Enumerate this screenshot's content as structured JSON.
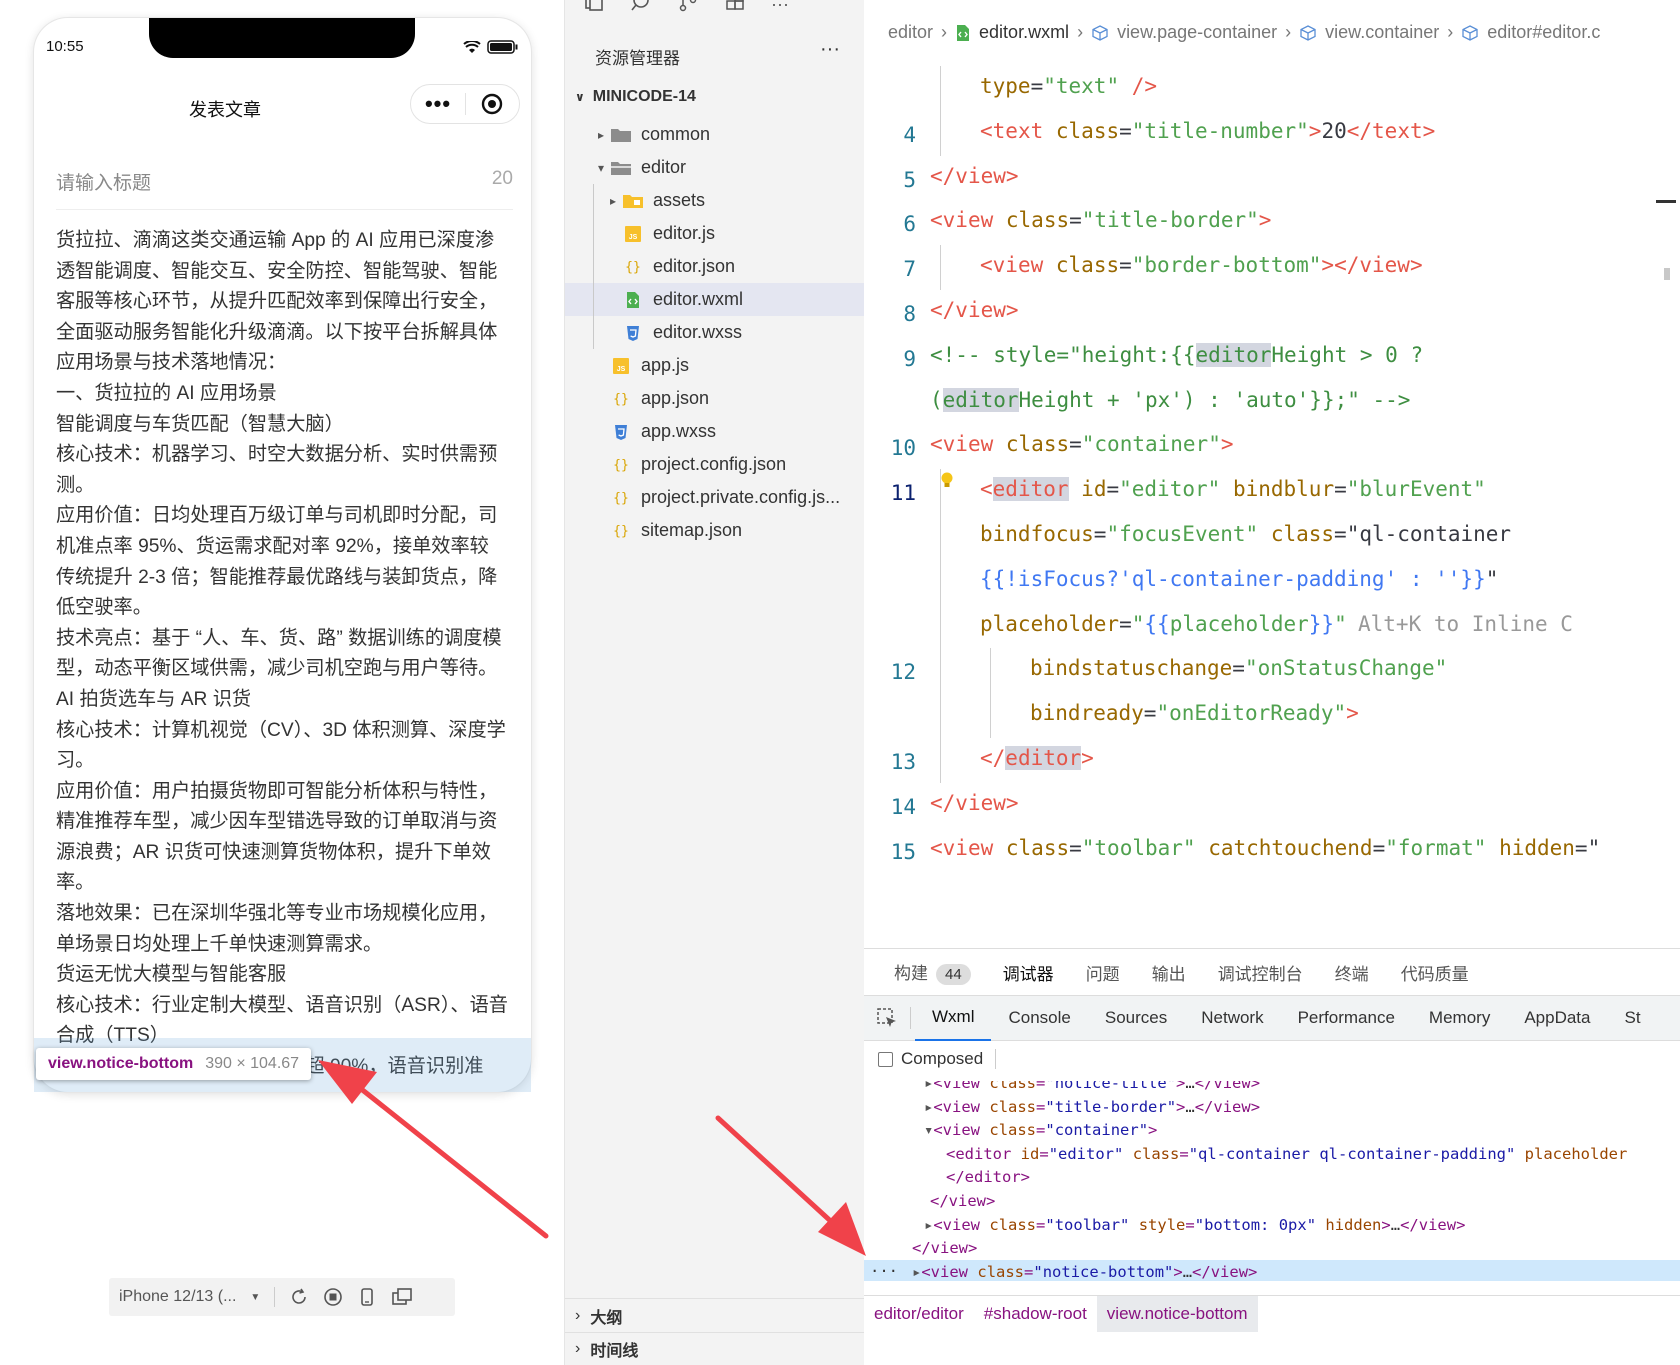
{
  "simulator": {
    "status_time": "10:55",
    "nav_title": "发表文章",
    "capsule_dots": "•••",
    "title_placeholder": "请输入标题",
    "title_count": "20",
    "paragraphs": [
      "货拉拉、滴滴这类交通运输 App 的 AI 应用已深度渗透智能调度、智能交互、安全防控、智能驾驶、智能客服等核心环节，从提升匹配效率到保障出行安全，全面驱动服务智能化升级滴滴。以下按平台拆解具体应用场景与技术落地情况：",
      "一、货拉拉的 AI 应用场景",
      "智能调度与车货匹配（智慧大脑）",
      "核心技术：机器学习、时空大数据分析、实时供需预测。",
      "应用价值：日均处理百万级订单与司机即时分配，司机准点率 95%、货运需求配对率 92%，接单效率较传统提升 2-3 倍；智能推荐最优路线与装卸货点，降低空驶率。",
      "技术亮点：基于 “人、车、货、路” 数据训练的调度模型，动态平衡区域供需，减少司机空跑与用户等待。",
      "AI 拍货选车与 AR 识货",
      "核心技术：计算机视觉（CV）、3D 体积测算、深度学习。",
      "应用价值：用户拍摄货物即可智能分析体积与特性，精准推荐车型，减少因车型错选导致的订单取消与资源浪费；AR 识货可快速测算货物体积，提升下单效率。",
      "落地效果：已在深圳华强北等专业市场规模化应用，单场景日均处理上千单快速测算需求。",
      "货运无忧大模型与智能客服",
      "核心技术：行业定制大模型、语音识别（ASR）、语音合成（TTS）",
      "应用价值：事实性问答准确率超 90%，语音识别准"
    ],
    "tooltip_selector": "view.notice-bottom",
    "tooltip_size": "390 × 104.67",
    "device_label": "iPhone 12/13 (..."
  },
  "explorer": {
    "title": "资源管理器",
    "more": "···",
    "project": "MINICODE-14",
    "tree": [
      {
        "label": "common",
        "type": "folder",
        "chevron": "▸"
      },
      {
        "label": "editor",
        "type": "folder-open",
        "chevron": "▾"
      },
      {
        "label": "assets",
        "type": "folder-assets",
        "chevron": "▸"
      },
      {
        "label": "editor.js",
        "type": "js"
      },
      {
        "label": "editor.json",
        "type": "json"
      },
      {
        "label": "editor.wxml",
        "type": "wxml"
      },
      {
        "label": "editor.wxss",
        "type": "wxss"
      },
      {
        "label": "app.js",
        "type": "js"
      },
      {
        "label": "app.json",
        "type": "json"
      },
      {
        "label": "app.wxss",
        "type": "wxss"
      },
      {
        "label": "project.config.json",
        "type": "json"
      },
      {
        "label": "project.private.config.js...",
        "type": "json"
      },
      {
        "label": "sitemap.json",
        "type": "json"
      }
    ],
    "bottom": [
      "大纲",
      "时间线"
    ]
  },
  "editor": {
    "tab_label": "editor.wxml",
    "breadcrumbs": [
      "editor",
      "editor.wxml",
      "view.page-container",
      "view.container",
      "editor#editor.c"
    ],
    "lines": [
      {
        "n": "",
        "t": "type=\"text\" />"
      },
      {
        "n": "4",
        "t": "<text class=\"title-number\">20</text>"
      },
      {
        "n": "5",
        "t": "</view>"
      },
      {
        "n": "6",
        "t": "<view class=\"title-border\">"
      },
      {
        "n": "7",
        "t": "<view class=\"border-bottom\"></view>"
      },
      {
        "n": "8",
        "t": "</view>"
      },
      {
        "n": "9",
        "t": "<!-- style=\"height:{{editorHeight > 0 ?"
      },
      {
        "n": "",
        "t": "(editorHeight + 'px') : 'auto'}};\" -->"
      },
      {
        "n": "10",
        "t": "<view class=\"container\">"
      },
      {
        "n": "11",
        "t": "<editor id=\"editor\" bindblur=\"blurEvent\""
      },
      {
        "n": "",
        "t": "bindfocus=\"focusEvent\" class=\"ql-container"
      },
      {
        "n": "",
        "t": "{{!isFocus?'ql-container-padding' : ''}}\""
      },
      {
        "n": "",
        "t": "placeholder=\"{{placeholder}}\""
      },
      {
        "n": "12",
        "t": "bindstatuschange=\"onStatusChange\""
      },
      {
        "n": "",
        "t": "bindready=\"onEditorReady\">"
      },
      {
        "n": "13",
        "t": "</editor>"
      },
      {
        "n": "14",
        "t": "</view>"
      },
      {
        "n": "15",
        "t": "<view class=\"toolbar\" catchtouchend=\"format\" hidden=\""
      }
    ],
    "inline_hint": "Alt+K to Inline C"
  },
  "devtools": {
    "top_tabs": [
      "构建",
      "调试器",
      "问题",
      "输出",
      "调试控制台",
      "终端",
      "代码质量"
    ],
    "build_badge": "44",
    "panel_tabs": [
      "Wxml",
      "Console",
      "Sources",
      "Network",
      "Performance",
      "Memory",
      "AppData",
      "St"
    ],
    "composed_label": "Composed",
    "dom_lines": [
      "▸<view class=\"notice-title\">…</view>",
      "▸<view class=\"title-border\">…</view>",
      "▾<view class=\"container\">",
      "<editor id=\"editor\" class=\"ql-container ql-container-padding\" placeholder",
      "</editor>",
      "</view>",
      "▸<view class=\"toolbar\" style=\"bottom: 0px\" hidden>…</view>",
      "</view>",
      "▸<view class=\"notice-bottom\">…</view>",
      "</editor/editor>"
    ],
    "breadcrumb_footer": [
      "editor/editor",
      "#shadow-root",
      "view.notice-bottom"
    ]
  },
  "colors": {
    "tag": "#e45649",
    "attr": "#986801",
    "string": "#50a14f",
    "dom_selected": "#cfe8fc",
    "arrow": "#f0424a"
  }
}
